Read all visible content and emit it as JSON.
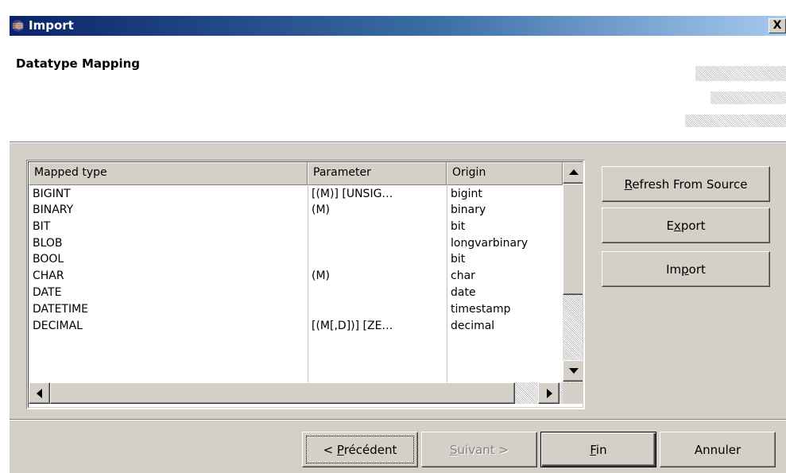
{
  "window": {
    "title": "Import",
    "close_glyph": "X",
    "icon": "eclipse-icon"
  },
  "page": {
    "title": "Datatype Mapping"
  },
  "table": {
    "columns": [
      "Mapped type",
      "Parameter",
      "Origin"
    ],
    "rows": [
      {
        "mapped": "BIGINT",
        "parameter": "[(M)] [UNSIG…",
        "origin": "bigint"
      },
      {
        "mapped": "BINARY",
        "parameter": "(M)",
        "origin": "binary"
      },
      {
        "mapped": "BIT",
        "parameter": "",
        "origin": "bit"
      },
      {
        "mapped": "BLOB",
        "parameter": "",
        "origin": "longvarbinary"
      },
      {
        "mapped": "BOOL",
        "parameter": "",
        "origin": "bit"
      },
      {
        "mapped": "CHAR",
        "parameter": "(M)",
        "origin": "char"
      },
      {
        "mapped": "DATE",
        "parameter": "",
        "origin": "date"
      },
      {
        "mapped": "DATETIME",
        "parameter": "",
        "origin": "timestamp"
      },
      {
        "mapped": "DECIMAL",
        "parameter": "[(M[,D])] [ZE…",
        "origin": "decimal"
      }
    ]
  },
  "side_buttons": {
    "refresh": {
      "mnemonic": "R",
      "rest": "efresh From Source"
    },
    "export": {
      "pre": "E",
      "mnemonic": "x",
      "rest": "port"
    },
    "import": {
      "pre": "Im",
      "mnemonic": "p",
      "rest": "ort"
    }
  },
  "footer": {
    "back": {
      "pre": "< ",
      "mnemonic": "P",
      "rest": "récédent"
    },
    "next": {
      "mnemonic": "S",
      "rest": "uivant >",
      "enabled": false
    },
    "finish": {
      "mnemonic": "F",
      "rest": "in"
    },
    "cancel": {
      "label": "Annuler"
    }
  },
  "colors": {
    "title_start": "#0a246a",
    "title_end": "#a6caf0",
    "face": "#d4d0c8"
  }
}
